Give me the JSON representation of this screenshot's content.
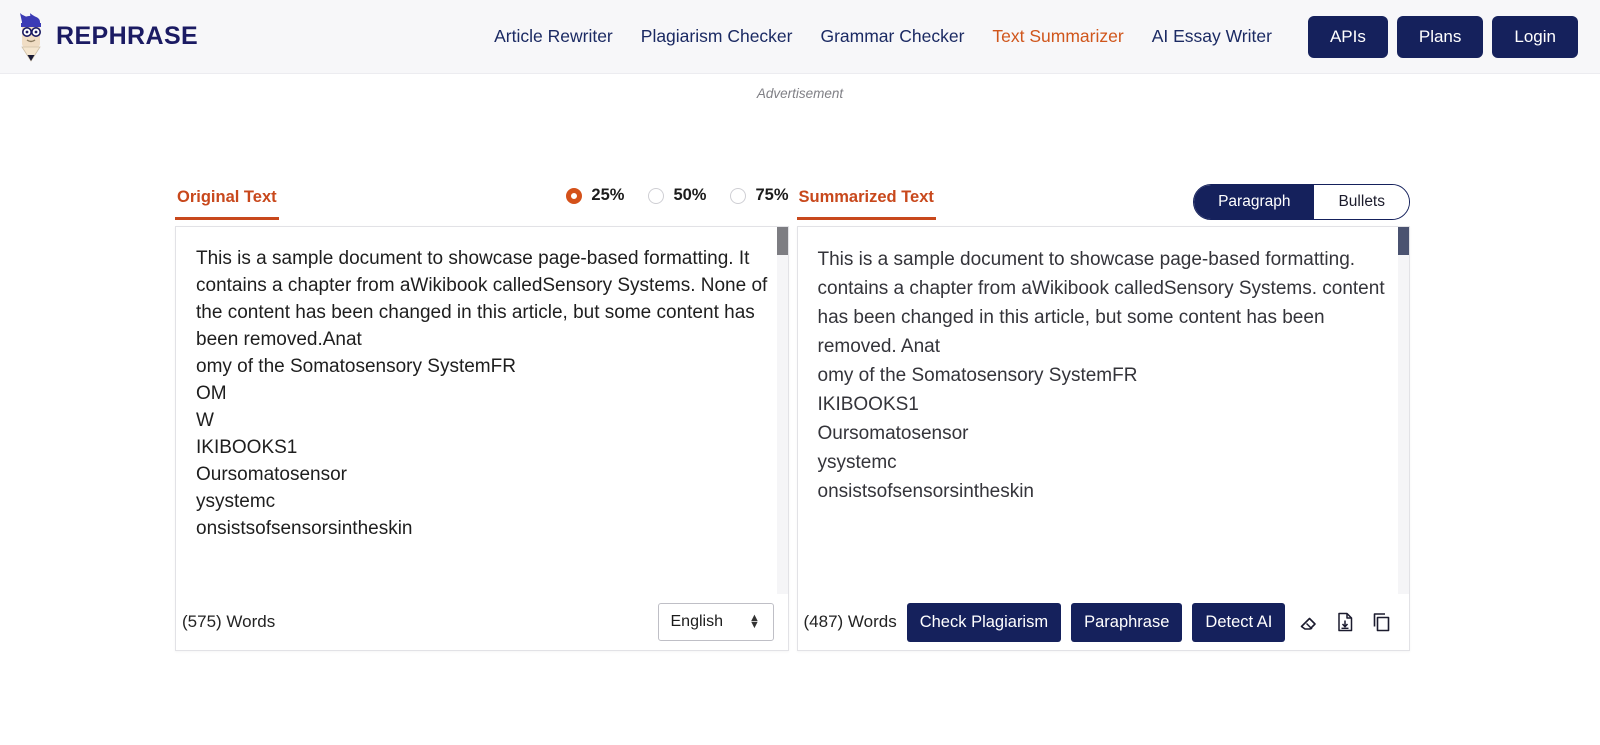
{
  "header": {
    "brand": "REPHRASE",
    "nav_links": [
      {
        "label": "Article Rewriter",
        "active": false
      },
      {
        "label": "Plagiarism Checker",
        "active": false
      },
      {
        "label": "Grammar Checker",
        "active": false
      },
      {
        "label": "Text Summarizer",
        "active": true
      },
      {
        "label": "AI Essay Writer",
        "active": false
      }
    ],
    "buttons": [
      "APIs",
      "Plans",
      "Login"
    ],
    "accent_color": "#d0561c",
    "navy_color": "#15215c"
  },
  "ad": {
    "label": "Advertisement"
  },
  "left_panel": {
    "title": "Original Text",
    "text": "This is a sample document to showcase page-based formatting. It contains a chapter from aWikibook calledSensory Systems. None of the content has been changed in this article, but some content has been removed.Anat\nomy of the Somatosensory SystemFR\nOM\n W\nIKIBOOKS1\nOursomatosensor\nysystemc\nonsistsofsensorsintheskin",
    "word_count": "(575) Words",
    "language": "English"
  },
  "summary_controls": {
    "percent_options": [
      {
        "label": "25%",
        "selected": true
      },
      {
        "label": "50%",
        "selected": false
      },
      {
        "label": "75%",
        "selected": false
      }
    ],
    "format_options": [
      {
        "label": "Paragraph",
        "active": true
      },
      {
        "label": "Bullets",
        "active": false
      }
    ]
  },
  "right_panel": {
    "title": "Summarized Text",
    "text": "This is a sample document to showcase page-based formatting. contains a chapter from aWikibook calledSensory Systems. content has been changed in this article, but some content has been removed. Anat\nomy of the Somatosensory SystemFR\nIKIBOOKS1\nOursomatosensor\nysystemc\nonsistsofsensorsintheskin",
    "word_count": "(487) Words",
    "actions": [
      "Check Plagiarism",
      "Paraphrase",
      "Detect AI"
    ],
    "icons": [
      "eraser-icon",
      "download-file-icon",
      "copy-icon"
    ]
  }
}
